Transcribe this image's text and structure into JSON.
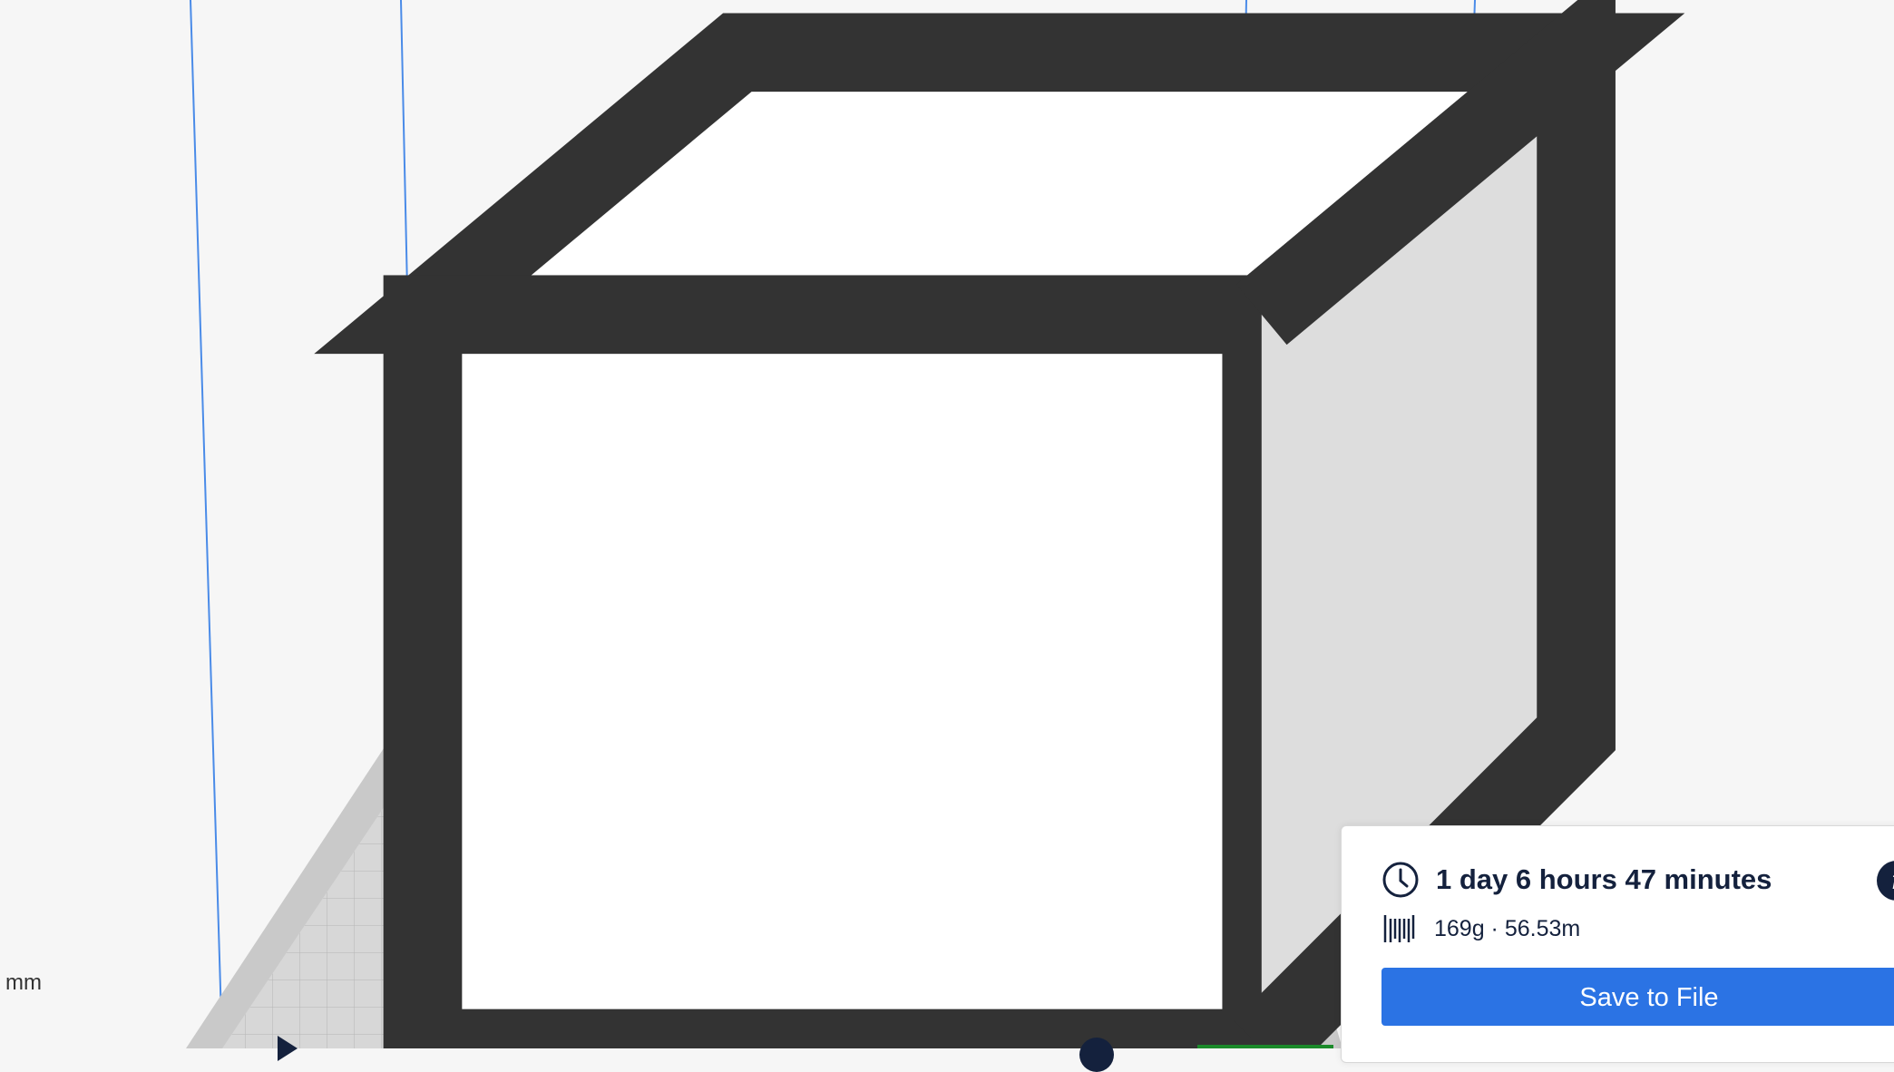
{
  "viewport": {
    "dimension_label": "mm",
    "model_color": "#f0d000",
    "build_plate_color": "#c8c8c8",
    "build_volume_line_color": "#4a8be8"
  },
  "print_panel": {
    "print_time": "1 day 6 hours 47 minutes",
    "material_usage": "169g · 56.53m",
    "save_button_label": "Save to File",
    "info_icon_glyph": "i",
    "accent_color": "#2b73e4",
    "text_color": "#14213d"
  },
  "icons": [
    "clock-icon",
    "spool-icon",
    "info-icon",
    "view-cube-icon",
    "play-icon"
  ]
}
